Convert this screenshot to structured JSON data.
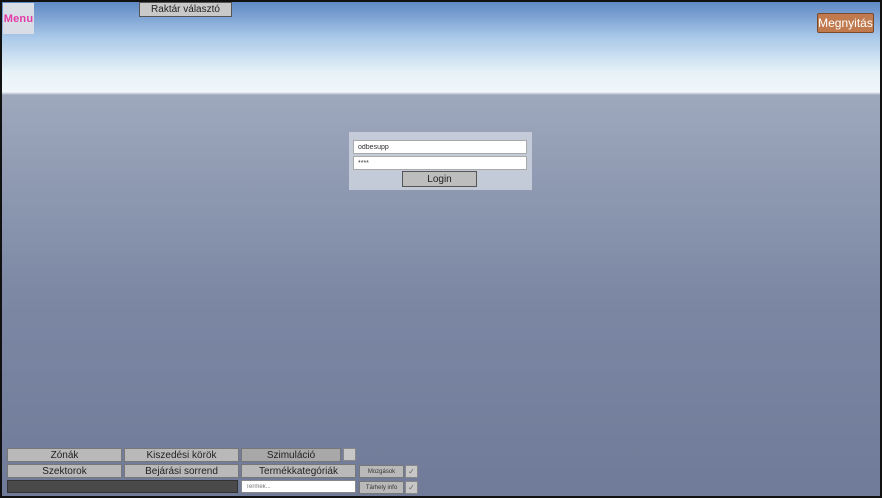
{
  "header": {
    "menu_label": "Menu",
    "warehouse_selector_label": "Raktár választó",
    "open_label": "Megnyitás"
  },
  "login": {
    "username_value": "odbesupp",
    "password_value": "****",
    "login_label": "Login"
  },
  "bottom": {
    "row1": [
      "Zónák",
      "Kiszedési körök",
      "Szimuláció"
    ],
    "row2": [
      "Szektorok",
      "Bejárási sorrend",
      "Termékkategóriák"
    ],
    "moves_label": "Mozgások",
    "storage_info_label": "Tárhely info",
    "search_placeholder": "Termék..."
  },
  "colors": {
    "menu_accent": "#e23aa6",
    "open_button": "#c07a4e"
  }
}
